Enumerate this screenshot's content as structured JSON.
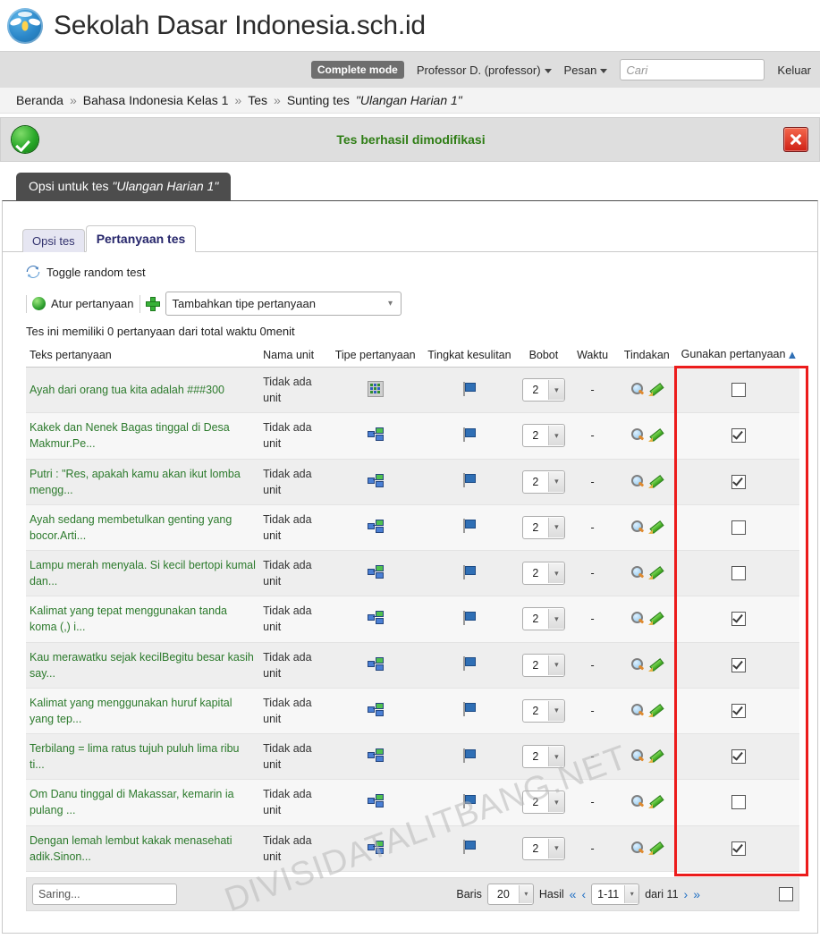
{
  "brand": {
    "title": "Sekolah Dasar Indonesia.sch.id",
    "logo_icon": "ministry-logo-icon"
  },
  "topnav": {
    "complete_mode": "Complete mode",
    "user": "Professor D. (professor)",
    "messages": "Pesan",
    "search_placeholder": "Cari",
    "logout": "Keluar"
  },
  "breadcrumb": {
    "items": [
      "Beranda",
      "Bahasa Indonesia Kelas 1",
      "Tes",
      "Sunting tes"
    ],
    "quoted": "\"Ulangan Harian 1\"",
    "separator": "»"
  },
  "notification": {
    "message": "Tes berhasil dimodifikasi",
    "success_icon": "check-circle-icon",
    "close_icon": "close-icon",
    "text_color": "#2e7d14"
  },
  "page_tab": {
    "prefix": "Opsi untuk tes",
    "quoted": "\"Ulangan Harian 1\""
  },
  "tabs": [
    {
      "label": "Opsi tes",
      "active": false
    },
    {
      "label": "Pertanyaan tes",
      "active": true
    }
  ],
  "toolbar": {
    "toggle_random": "Toggle random test",
    "toggle_icon": "refresh-icon",
    "arrange_questions": "Atur pertanyaan",
    "arrange_icon": "green-recycle-icon",
    "add_icon": "plus-icon",
    "add_question_type": "Tambahkan tipe pertanyaan",
    "info": "Tes ini memiliki 0 pertanyaan dari total waktu 0menit"
  },
  "table": {
    "headers": {
      "text": "Teks pertanyaan",
      "unit": "Nama unit",
      "type": "Tipe pertanyaan",
      "difficulty": "Tingkat kesulitan",
      "weight": "Bobot",
      "time": "Waktu",
      "action": "Tindakan",
      "use": "Gunakan pertanyaan"
    },
    "sort_icon": "sort-ascending-icon",
    "rows": [
      {
        "text": "Ayah dari orang tua kita adalah ###300",
        "unit": "Tidak ada\nunit",
        "type_icon": "matrix-question-icon",
        "difficulty_icon": "flag-icon",
        "weight": "2",
        "time": "-",
        "preview_icon": "magnifier-icon",
        "edit_icon": "pencil-icon",
        "used": false
      },
      {
        "text": "Kakek dan Nenek Bagas tinggal di Desa Makmur.Pe...",
        "unit": "Tidak ada\nunit",
        "type_icon": "multichoice-question-icon",
        "difficulty_icon": "flag-icon",
        "weight": "2",
        "time": "-",
        "preview_icon": "magnifier-icon",
        "edit_icon": "pencil-icon",
        "used": true
      },
      {
        "text": "Putri : \"Res, apakah kamu akan ikut lomba mengg...",
        "unit": "Tidak ada\nunit",
        "type_icon": "multichoice-question-icon",
        "difficulty_icon": "flag-icon",
        "weight": "2",
        "time": "-",
        "preview_icon": "magnifier-icon",
        "edit_icon": "pencil-icon",
        "used": true
      },
      {
        "text": "Ayah sedang membetulkan genting yang bocor.Arti...",
        "unit": "Tidak ada\nunit",
        "type_icon": "multichoice-question-icon",
        "difficulty_icon": "flag-icon",
        "weight": "2",
        "time": "-",
        "preview_icon": "magnifier-icon",
        "edit_icon": "pencil-icon",
        "used": false
      },
      {
        "text": "Lampu merah menyala. Si kecil bertopi kumal dan...",
        "unit": "Tidak ada\nunit",
        "type_icon": "multichoice-question-icon",
        "difficulty_icon": "flag-icon",
        "weight": "2",
        "time": "-",
        "preview_icon": "magnifier-icon",
        "edit_icon": "pencil-icon",
        "used": false
      },
      {
        "text": "Kalimat yang tepat menggunakan tanda koma (,) i...",
        "unit": "Tidak ada\nunit",
        "type_icon": "multichoice-question-icon",
        "difficulty_icon": "flag-icon",
        "weight": "2",
        "time": "-",
        "preview_icon": "magnifier-icon",
        "edit_icon": "pencil-icon",
        "used": true
      },
      {
        "text": "Kau merawatku sejak kecilBegitu besar kasih say...",
        "unit": "Tidak ada\nunit",
        "type_icon": "multichoice-question-icon",
        "difficulty_icon": "flag-icon",
        "weight": "2",
        "time": "-",
        "preview_icon": "magnifier-icon",
        "edit_icon": "pencil-icon",
        "used": true
      },
      {
        "text": "Kalimat yang menggunakan huruf kapital yang tep...",
        "unit": "Tidak ada\nunit",
        "type_icon": "multichoice-question-icon",
        "difficulty_icon": "flag-icon",
        "weight": "2",
        "time": "-",
        "preview_icon": "magnifier-icon",
        "edit_icon": "pencil-icon",
        "used": true
      },
      {
        "text": "Terbilang = lima ratus tujuh puluh lima ribu ti...",
        "unit": "Tidak ada\nunit",
        "type_icon": "multichoice-question-icon",
        "difficulty_icon": "flag-icon",
        "weight": "2",
        "time": "-",
        "preview_icon": "magnifier-icon",
        "edit_icon": "pencil-icon",
        "used": true
      },
      {
        "text": "Om Danu tinggal di Makassar, kemarin ia pulang ...",
        "unit": "Tidak ada\nunit",
        "type_icon": "multichoice-question-icon",
        "difficulty_icon": "flag-icon",
        "weight": "2",
        "time": "-",
        "preview_icon": "magnifier-icon",
        "edit_icon": "pencil-icon",
        "used": false
      },
      {
        "text": "Dengan lemah lembut kakak menasehati adik.Sinon...",
        "unit": "Tidak ada\nunit",
        "type_icon": "multichoice-question-icon",
        "difficulty_icon": "flag-icon",
        "weight": "2",
        "time": "-",
        "preview_icon": "magnifier-icon",
        "edit_icon": "pencil-icon",
        "used": true
      }
    ]
  },
  "footer": {
    "filter_placeholder": "Saring...",
    "rows_label": "Baris",
    "rows_value": "20",
    "results_label": "Hasil",
    "range_value": "1-11",
    "of_label": "dari 11",
    "first_icon": "double-left-icon",
    "prev_icon": "left-icon",
    "next_icon": "right-icon",
    "last_icon": "double-right-icon",
    "select_all": false
  },
  "watermark": "DIVISIDATALITBANG.NET",
  "highlight_color": "#ec1c1c"
}
